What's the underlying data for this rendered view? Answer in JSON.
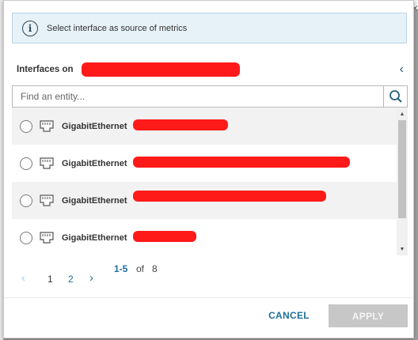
{
  "colors": {
    "accent": "#1f6f9a",
    "redaction": "#ff1a1a",
    "apply_disabled": "#c7c7c7",
    "banner_bg": "#e6f1f8"
  },
  "backdrop": {
    "close_glyph": "×"
  },
  "info": {
    "icon": "info-icon",
    "message": "Select interface as source of metrics"
  },
  "section": {
    "title": "Interfaces on",
    "collapse_icon": "chevron-left-icon",
    "collapse_glyph": "‹"
  },
  "search": {
    "placeholder": "Find an entity...",
    "icon": "search-icon"
  },
  "interfaces": [
    {
      "label": "GigabitEthernet",
      "selected": false,
      "icon": "ethernet-port-icon"
    },
    {
      "label": "GigabitEthernet",
      "selected": false,
      "icon": "ethernet-port-icon"
    },
    {
      "label": "GigabitEthernet",
      "selected": false,
      "icon": "ethernet-port-icon"
    },
    {
      "label": "GigabitEthernet",
      "selected": false,
      "icon": "ethernet-port-icon"
    }
  ],
  "scrollbar": {
    "up_glyph": "▲",
    "down_glyph": "▼"
  },
  "pagination": {
    "prev": "‹",
    "pages": [
      "1",
      "2"
    ],
    "current": "1",
    "next": "›",
    "range": "1-5",
    "of_label": "of",
    "total": "8"
  },
  "footer": {
    "cancel_label": "CANCEL",
    "apply_label": "APPLY"
  }
}
